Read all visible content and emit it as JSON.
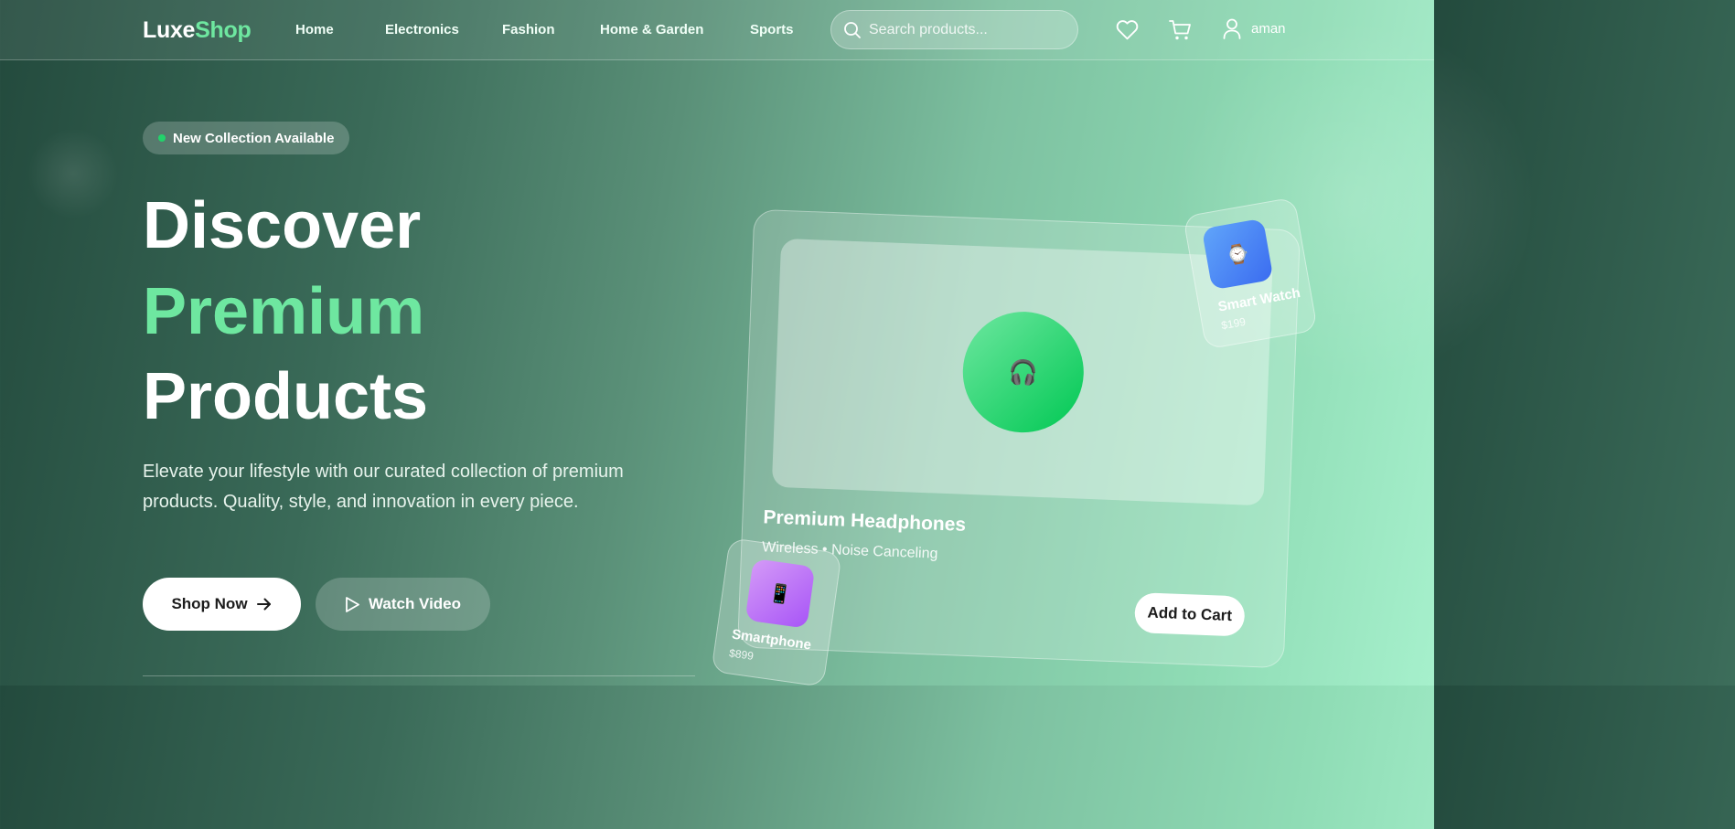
{
  "brand": {
    "part1": "Luxe",
    "part2": "Shop"
  },
  "nav": {
    "links": [
      "Home",
      "Electronics",
      "Fashion",
      "Home & Garden",
      "Sports"
    ],
    "search_placeholder": "Search products...",
    "user_name": "aman",
    "icons": [
      "search-icon",
      "heart-icon",
      "cart-icon",
      "user-icon"
    ]
  },
  "hero": {
    "badge": "New Collection Available",
    "title_line1": "Discover",
    "title_line2": "Premium",
    "title_line3": "Products",
    "description": "Elevate your lifestyle with our curated collection of premium products. Quality, style, and innovation in every piece.",
    "primary_button": "Shop Now",
    "secondary_button": "Watch Video"
  },
  "featured_card": {
    "title": "Premium Headphones",
    "subtitle": "Wireless • Noise Canceling",
    "cta": "Add to Cart",
    "emoji": "🎧"
  },
  "floating_products": [
    {
      "name": "Smart Watch",
      "price": "$199",
      "emoji": "⌚"
    },
    {
      "name": "Smartphone",
      "price": "$899",
      "emoji": "📱"
    }
  ],
  "colors": {
    "accent_green": "#6ee7a0",
    "badge_dot": "#22d36b",
    "headphone_circle": "#00c853",
    "watch_tile": "#3b6cf0",
    "phone_tile": "#a855f7"
  }
}
